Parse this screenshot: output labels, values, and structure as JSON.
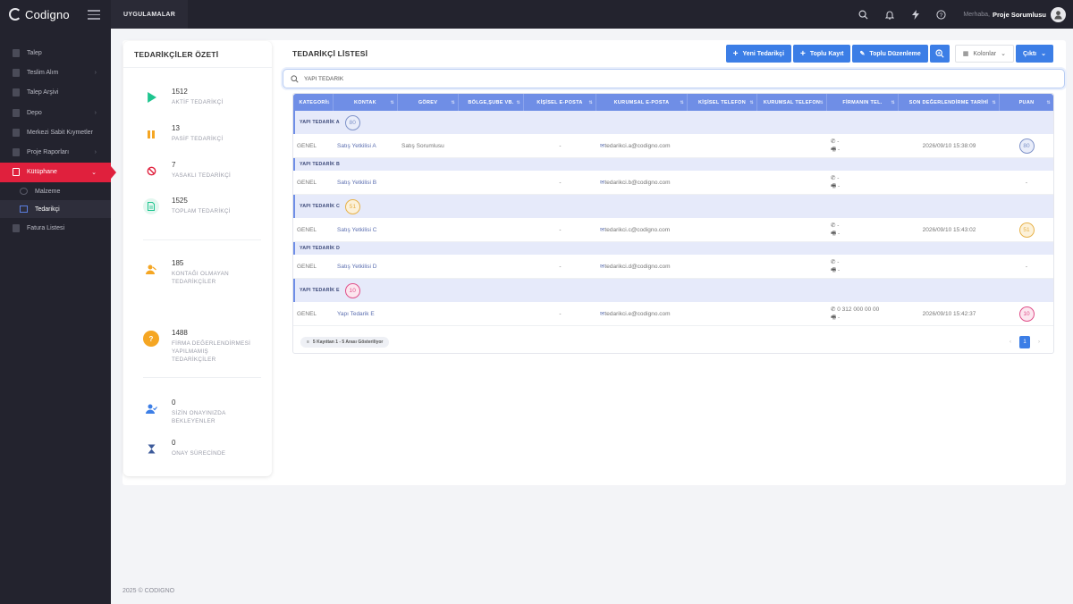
{
  "brand": {
    "name": "Codigno"
  },
  "topbar": {
    "apps_label": "UYGULAMALAR",
    "greeting": "Merhaba,",
    "username": "Proje Sorumlusu",
    "icons": [
      "search-icon",
      "bell-icon",
      "bolt-icon",
      "help-icon"
    ]
  },
  "sidebar": {
    "items": [
      {
        "label": "Talep",
        "chevron": false
      },
      {
        "label": "Teslim Alım",
        "chevron": true
      },
      {
        "label": "Talep Arşivi",
        "chevron": false
      },
      {
        "label": "Depo",
        "chevron": true
      },
      {
        "label": "Merkezi Sabit Kıymetler",
        "chevron": false
      },
      {
        "label": "Proje Raporları",
        "chevron": true
      },
      {
        "label": "Kütüphane",
        "chevron": true,
        "active": true
      }
    ],
    "subitems": [
      {
        "label": "Malzeme"
      },
      {
        "label": "Tedarikçi",
        "active": true
      }
    ],
    "after": [
      {
        "label": "Fatura Listesi"
      }
    ]
  },
  "summary": {
    "title": "TEDARİKÇİLER ÖZETİ",
    "stats": [
      {
        "value": "1512",
        "label": "AKTİF TEDARİKÇİ",
        "icon": "play-icon",
        "color": "#1ec58f",
        "bg": "#e4f7f0"
      },
      {
        "value": "13",
        "label": "PASİF TEDARİKÇİ",
        "icon": "pause-icon",
        "color": "#f5a623",
        "bg": "#fdf2e1"
      },
      {
        "value": "7",
        "label": "YASAKLI TEDARİKÇİ",
        "icon": "ban-icon",
        "color": "#e0203d",
        "bg": "#fde6ea"
      },
      {
        "value": "1525",
        "label": "TOPLAM TEDARİKÇİ",
        "icon": "document-icon",
        "color": "#1ec58f",
        "bg": "#e4f7f0"
      },
      {
        "value": "185",
        "label": "KONTAĞI OLMAYAN TEDARİKÇİLER",
        "icon": "user-off-icon",
        "color": "#f5a623",
        "bg": "#fdf2e1"
      },
      {
        "value": "1488",
        "label": "FİRMA DEĞERLENDİRMESİ YAPILMAMIŞ TEDARİKÇİLER",
        "icon": "question-icon",
        "color": "#f5a623",
        "bg": "#fdf2e1"
      },
      {
        "value": "0",
        "label": "SİZİN ONAYINIZDA BEKLEYENLER",
        "icon": "user-check-icon",
        "color": "#3c7ee6",
        "bg": "#ffffff"
      },
      {
        "value": "0",
        "label": "ONAY SÜRECİNDE",
        "icon": "hourglass-icon",
        "color": "#3c5a9a",
        "bg": "#ffffff"
      }
    ]
  },
  "list": {
    "title": "TEDARİKÇİ LİSTESİ",
    "buttons": {
      "new": "Yeni Tedarikçi",
      "bulk": "Toplu Kayıt",
      "bulk_edit": "Toplu Düzenleme",
      "columns": "Kolonlar",
      "export": "Çıktı"
    },
    "search_value": "YAPI TEDARİK",
    "columns": [
      "KATEGORİ",
      "KONTAK",
      "GÖREV",
      "BÖLGE,ŞUBE VB.",
      "KİŞİSEL E-POSTA",
      "KURUMSAL E-POSTA",
      "KİŞİSEL TELEFON",
      "KURUMSAL TELEFON",
      "FİRMANIN TEL.",
      "SON DEĞERLENDİRME TARİHİ",
      "PUAN"
    ],
    "groups": [
      {
        "name": "YAPI TEDARİK A",
        "score": "80",
        "score_color": "#7f93c9",
        "score_bg": "#e9edfa",
        "row": {
          "category": "GENEL",
          "contact": "Satış Yetkilisi A",
          "role": "Satış Sorumlusu",
          "region": "",
          "personal_email": "-",
          "corporate_email": "tedarikci.a@codigno.com",
          "personal_phone": "",
          "corporate_phone": "",
          "phone1": "-",
          "phone2": "-",
          "date": "2026/09/10 15:38:09",
          "score": "80"
        }
      },
      {
        "name": "YAPI TEDARİK B",
        "score": "",
        "score_color": "",
        "score_bg": "",
        "row": {
          "category": "GENEL",
          "contact": "Satış Yetkilisi B",
          "role": "",
          "region": "",
          "personal_email": "-",
          "corporate_email": "tedarikci.b@codigno.com",
          "personal_phone": "",
          "corporate_phone": "",
          "phone1": "-",
          "phone2": "-",
          "date": "",
          "score": "-"
        }
      },
      {
        "name": "YAPI TEDARİK C",
        "score": "51",
        "score_color": "#e7b24a",
        "score_bg": "#fcf1d9",
        "row": {
          "category": "GENEL",
          "contact": "Satış Yetkilisi C",
          "role": "",
          "region": "",
          "personal_email": "-",
          "corporate_email": "tedarikci.c@codigno.com",
          "personal_phone": "",
          "corporate_phone": "",
          "phone1": "-",
          "phone2": "-",
          "date": "2026/09/10 15:43:02",
          "score": "51"
        }
      },
      {
        "name": "YAPI TEDARİK D",
        "score": "",
        "score_color": "",
        "score_bg": "",
        "row": {
          "category": "GENEL",
          "contact": "Satış Yetkilisi D",
          "role": "",
          "region": "",
          "personal_email": "-",
          "corporate_email": "tedarikci.d@codigno.com",
          "personal_phone": "",
          "corporate_phone": "",
          "phone1": "-",
          "phone2": "-",
          "date": "",
          "score": "-"
        }
      },
      {
        "name": "YAPI TEDARİK E",
        "score": "10",
        "score_color": "#e0508a",
        "score_bg": "#fce6ef",
        "row": {
          "category": "GENEL",
          "contact": "Yapı Tedarik E",
          "role": "",
          "region": "",
          "personal_email": "-",
          "corporate_email": "tedarikci.e@codigno.com",
          "personal_phone": "",
          "corporate_phone": "",
          "phone1": "0 312 000 00 00",
          "phone2": "-",
          "date": "2026/09/10 15:42:37",
          "score": "10"
        }
      }
    ],
    "footer_info": "5 Kayıttan 1 - 5 Arası Gösteriliyor",
    "page": "1"
  },
  "footer": {
    "text": "2025 © CODIGNO"
  }
}
